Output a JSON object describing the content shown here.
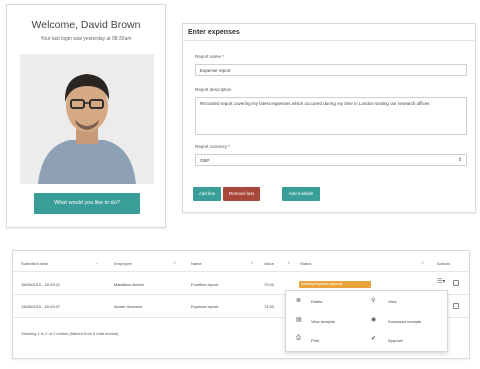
{
  "welcome": {
    "title": "Welcome, David Brown",
    "subtitle": "Your last login was yesterday at 08:32am",
    "ask_button": "What would you like to do?"
  },
  "expenses": {
    "title": "Enter expenses",
    "name_label": "Report name",
    "name_value": "Expense report",
    "desc_label": "Report description",
    "desc_value": "Recorded report covering my latest expenses which occurred during my time in London visiting our research offices",
    "currency_label": "Report currency",
    "currency_value": "GBP",
    "required_mark": "*",
    "buttons": {
      "add_line": "Add line",
      "remove_last": "Remove last",
      "add_multiple": "Add multiple"
    }
  },
  "table": {
    "columns": [
      "Submitted date",
      "Employee",
      "Name",
      "Value",
      "Status",
      "Actions"
    ],
    "rows": [
      {
        "date": "15/05/2015 - 20:43:21",
        "employee": "Maddison Archer",
        "name": "Frontline report",
        "value": "70.00",
        "status": "Awaiting employee approval"
      },
      {
        "date": "13/05/2015 - 20:43:37",
        "employee": "Aimee Hancock",
        "name": "Expense report",
        "value": "74.50",
        "status": ""
      }
    ],
    "footer": "Showing 1 to 2 of 2 entries (filtered from 6 total entries)"
  },
  "menu": {
    "items": [
      {
        "label": "Delete",
        "icon": "x-circle-icon"
      },
      {
        "label": "View",
        "icon": "magnifier-icon"
      },
      {
        "label": "View receipts",
        "icon": "receipt-icon"
      },
      {
        "label": "Download receipts",
        "icon": "eye-icon"
      },
      {
        "label": "Print",
        "icon": "printer-icon"
      },
      {
        "label": "Approve",
        "icon": "checkmark-icon"
      }
    ]
  },
  "colors": {
    "teal": "#3a9e98",
    "red": "#a8483a",
    "orange": "#e8a33c",
    "border": "#d9d9d9"
  }
}
